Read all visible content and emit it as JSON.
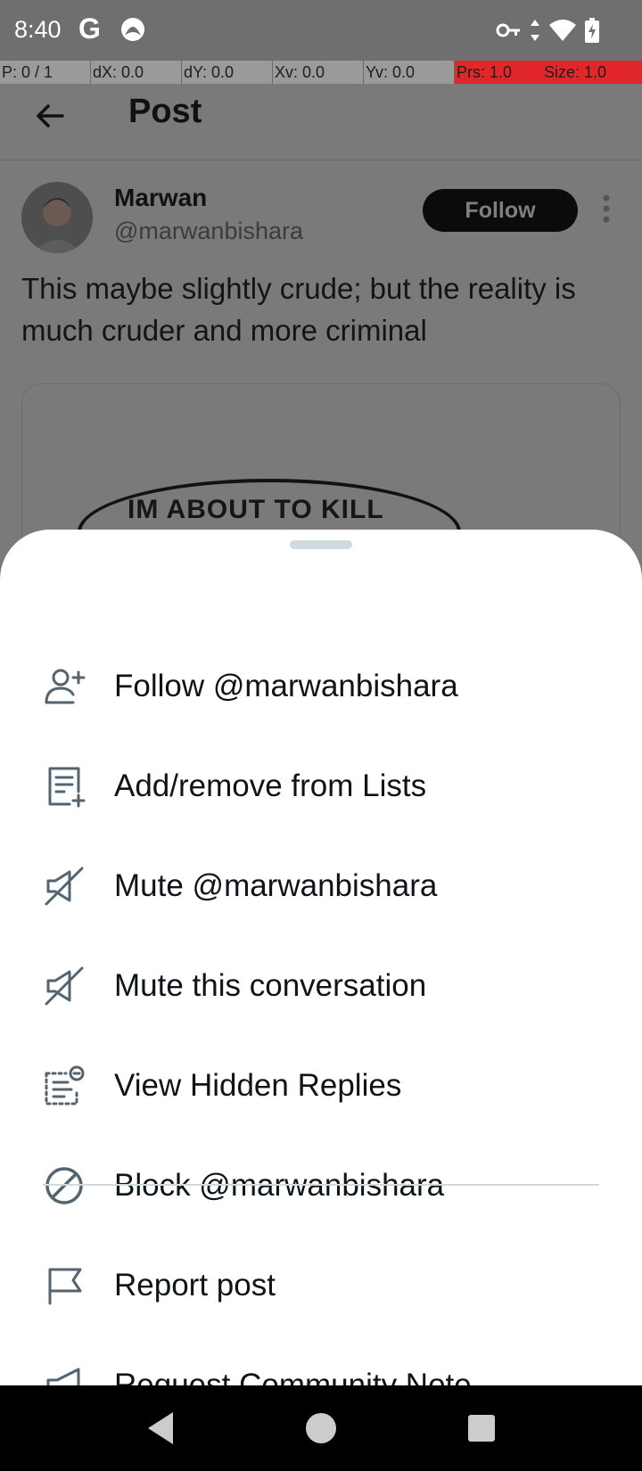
{
  "status_bar": {
    "time": "8:40",
    "left_icons": [
      "google-icon",
      "app-notification-icon"
    ],
    "right_icons": [
      "vpn-key-icon",
      "data-arrows-icon",
      "wifi-icon",
      "battery-charging-icon"
    ]
  },
  "debug_bar": {
    "pointers": "P: 0 / 1",
    "dx": "dX: 0.0",
    "dy": "dY: 0.0",
    "xv": "Xv: 0.0",
    "yv": "Yv: 0.0",
    "prs": "Prs: 1.0",
    "size": "Size: 1.0"
  },
  "header": {
    "title": "Post"
  },
  "post": {
    "author_name": "Marwan",
    "author_handle": "@marwanbishara",
    "follow_label": "Follow",
    "text": "This maybe slightly crude; but the reality is much cruder and more criminal",
    "media_caption": "IM ABOUT TO KILL"
  },
  "sheet": {
    "items": [
      {
        "label": "Follow @marwanbishara",
        "icon": "add-user-icon"
      },
      {
        "label": "Add/remove from Lists",
        "icon": "list-add-icon"
      },
      {
        "label": "Mute @marwanbishara",
        "icon": "mute-icon"
      },
      {
        "label": "Mute this conversation",
        "icon": "mute-conversation-icon"
      },
      {
        "label": "View Hidden Replies",
        "icon": "hidden-replies-icon"
      },
      {
        "label": "Block @marwanbishara",
        "icon": "block-icon"
      },
      {
        "label": "Report post",
        "icon": "flag-icon"
      },
      {
        "label": "Request Community Note",
        "icon": "megaphone-icon"
      }
    ]
  },
  "colors": {
    "scrim": "#7a7a7a",
    "sheet_bg": "#ffffff",
    "text_primary": "#0f1419",
    "divider": "#cfd9de",
    "debug_alert": "#e2272a"
  }
}
